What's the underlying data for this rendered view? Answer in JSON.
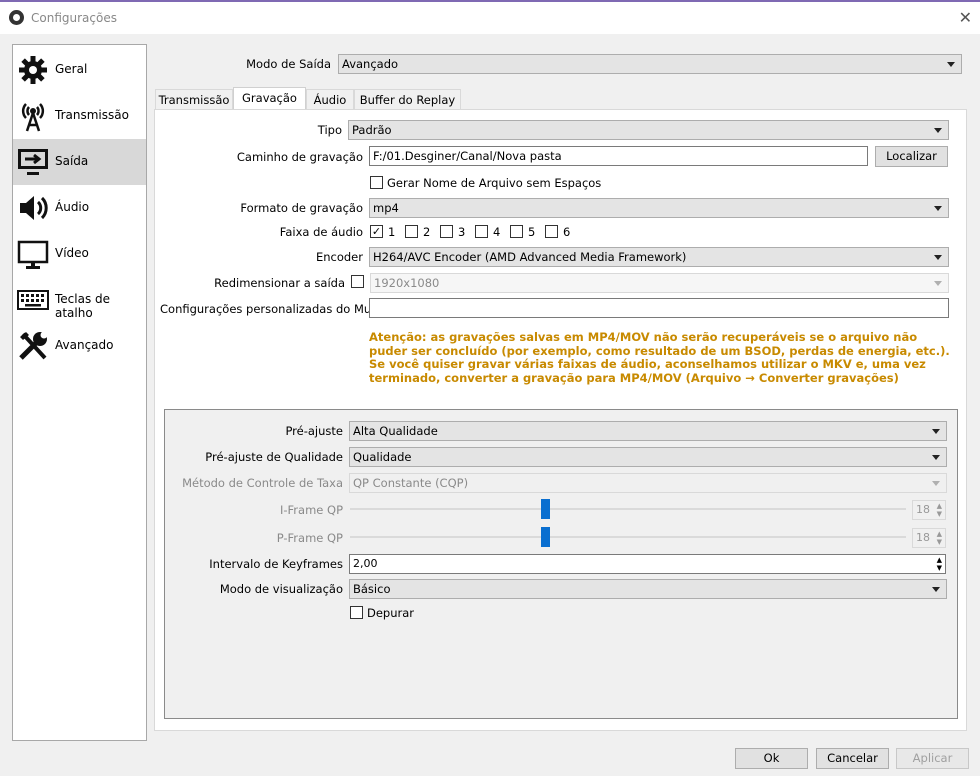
{
  "window": {
    "title": "Configurações",
    "close_glyph": "✕"
  },
  "sidebar": {
    "items": [
      {
        "label": "Geral",
        "icon": "gear-icon"
      },
      {
        "label": "Transmissão",
        "icon": "antenna-icon"
      },
      {
        "label": "Saída",
        "icon": "output-icon",
        "selected": true
      },
      {
        "label": "Áudio",
        "icon": "speaker-icon"
      },
      {
        "label": "Vídeo",
        "icon": "monitor-icon"
      },
      {
        "label": "Teclas de atalho",
        "icon": "keyboard-icon"
      },
      {
        "label": "Avançado",
        "icon": "tools-icon"
      }
    ]
  },
  "output_mode": {
    "label": "Modo de Saída",
    "value": "Avançado"
  },
  "tabs": [
    "Transmissão",
    "Gravação",
    "Áudio",
    "Buffer do Replay"
  ],
  "selected_tab": "Gravação",
  "recording": {
    "type": {
      "label": "Tipo",
      "value": "Padrão"
    },
    "path": {
      "label": "Caminho de gravação",
      "value": "F:/01.Desginer/Canal/Nova pasta",
      "browse": "Localizar"
    },
    "no_space_filename": {
      "label": "Gerar Nome de Arquivo sem Espaços",
      "checked": false
    },
    "format": {
      "label": "Formato de gravação",
      "value": "mp4"
    },
    "audio_track": {
      "label": "Faixa de áudio",
      "tracks": [
        "1",
        "2",
        "3",
        "4",
        "5",
        "6"
      ],
      "checked": [
        true,
        false,
        false,
        false,
        false,
        false
      ]
    },
    "encoder": {
      "label": "Encoder",
      "value": "H264/AVC Encoder (AMD Advanced Media Framework)"
    },
    "rescale": {
      "label": "Redimensionar a saída",
      "value": "1920x1080",
      "checked": false
    },
    "muxer": {
      "label": "Configurações personalizadas do Muxer",
      "value": ""
    },
    "warning": "Atenção: as gravações salvas em MP4/MOV não serão recuperáveis se o arquivo não puder ser concluído (por exemplo, como resultado de um BSOD, perdas de energia, etc.). Se você quiser gravar várias faixas de áudio, aconselhamos utilizar o MKV e, uma vez terminado, converter a gravação para MP4/MOV (Arquivo → Converter gravações)"
  },
  "encoder_settings": {
    "preset": {
      "label": "Pré-ajuste",
      "value": "Alta Qualidade"
    },
    "quality_preset": {
      "label": "Pré-ajuste de Qualidade",
      "value": "Qualidade"
    },
    "rate_control": {
      "label": "Método de Controle de Taxa",
      "value": "QP Constante (CQP)"
    },
    "iframe_qp": {
      "label": "I-Frame QP",
      "value": "18",
      "level": 0.35
    },
    "pframe_qp": {
      "label": "P-Frame QP",
      "value": "18",
      "level": 0.35
    },
    "keyframe_interval": {
      "label": "Intervalo de Keyframes",
      "value": "2,00"
    },
    "view_mode": {
      "label": "Modo de visualização",
      "value": "Básico"
    },
    "debug": {
      "label": "Depurar",
      "checked": false
    }
  },
  "footer": {
    "ok": "Ok",
    "cancel": "Cancelar",
    "apply": "Aplicar"
  },
  "colors": {
    "accent": "#0a6fd0",
    "warning": "#c88a00",
    "selected_item": "#d8d8d8"
  }
}
